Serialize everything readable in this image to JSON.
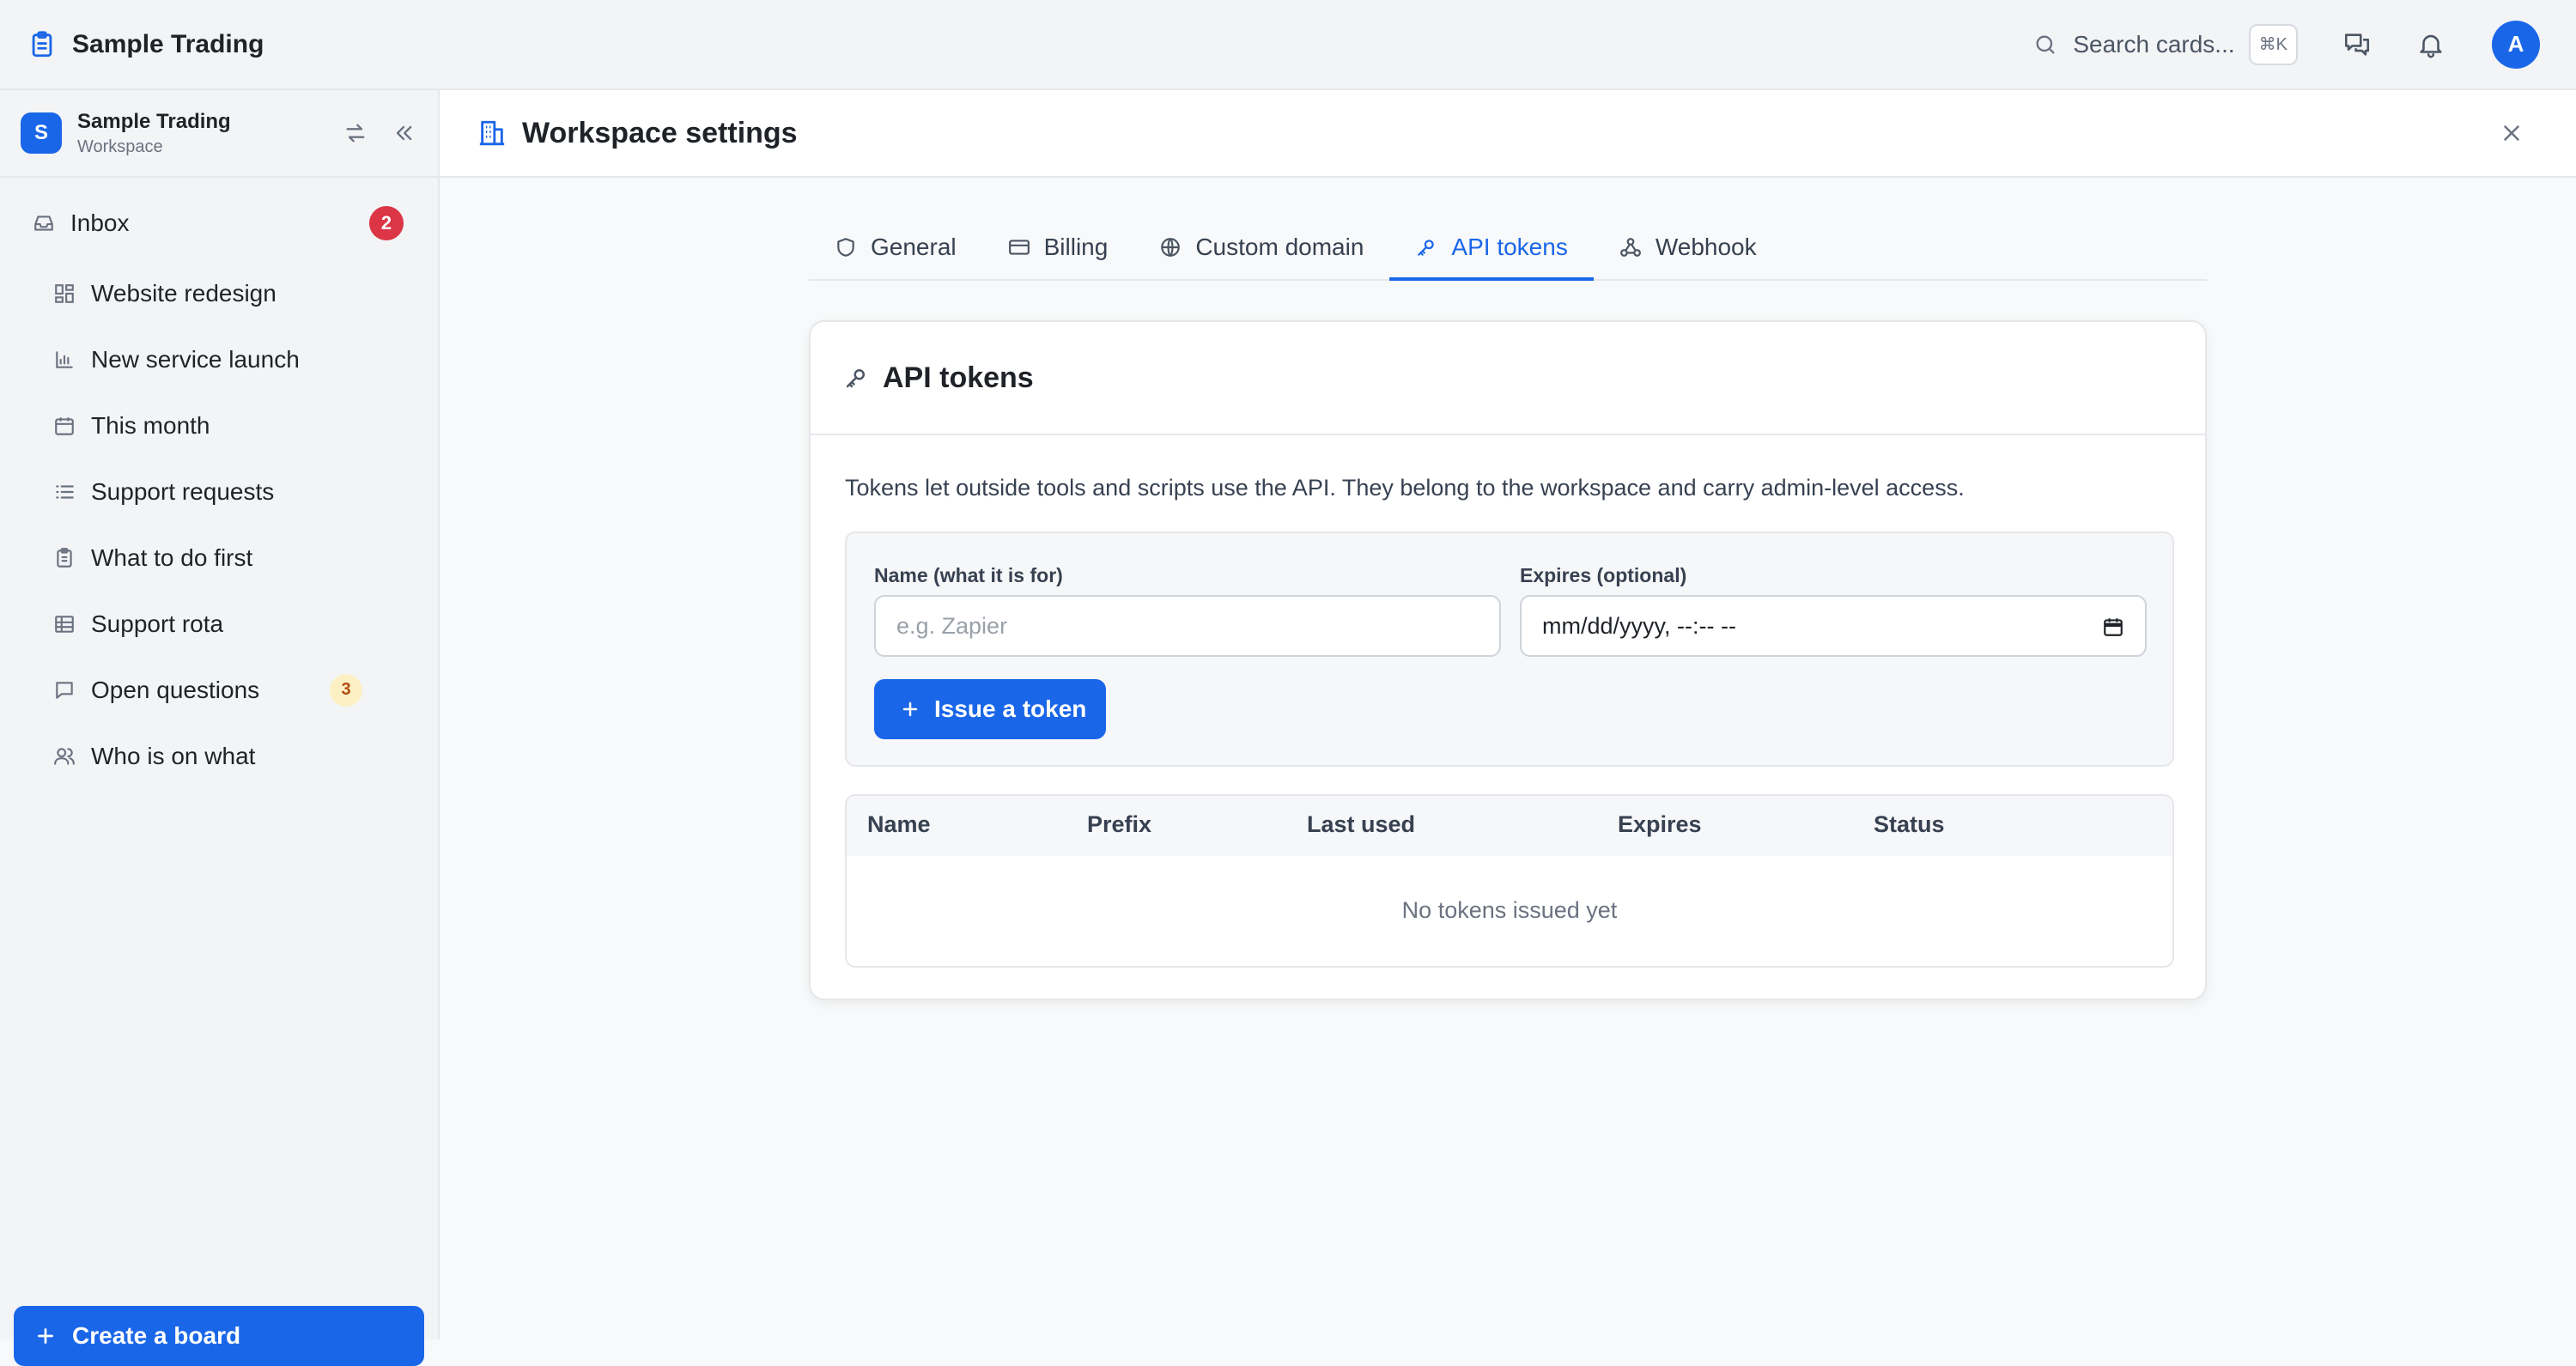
{
  "app": {
    "title": "Sample Trading",
    "search_placeholder": "Search cards...",
    "search_shortcut": "⌘K",
    "avatar_initial": "A",
    "accent_color": "#1a66e8"
  },
  "sidebar": {
    "workspace_initial": "S",
    "workspace_name": "Sample Trading",
    "workspace_type": "Workspace",
    "inbox": {
      "label": "Inbox",
      "badge": "2"
    },
    "items": [
      {
        "label": "Website redesign",
        "icon": "dashboard-grid-icon"
      },
      {
        "label": "New service launch",
        "icon": "chart-icon"
      },
      {
        "label": "This month",
        "icon": "calendar-icon"
      },
      {
        "label": "Support requests",
        "icon": "list-icon"
      },
      {
        "label": "What to do first",
        "icon": "clipboard-icon"
      },
      {
        "label": "Support rota",
        "icon": "table-icon"
      },
      {
        "label": "Open questions",
        "icon": "chat-bubble-icon",
        "badge": "3"
      },
      {
        "label": "Who is on what",
        "icon": "users-icon"
      }
    ],
    "create_label": "Create a board"
  },
  "main": {
    "title": "Workspace settings",
    "tabs": [
      {
        "label": "General",
        "icon": "shield-icon"
      },
      {
        "label": "Billing",
        "icon": "credit-card-icon"
      },
      {
        "label": "Custom domain",
        "icon": "globe-icon"
      },
      {
        "label": "API tokens",
        "icon": "key-icon",
        "active": true
      },
      {
        "label": "Webhook",
        "icon": "webhook-icon"
      }
    ],
    "card": {
      "title": "API tokens",
      "description": "Tokens let outside tools and scripts use the API. They belong to the workspace and carry admin-level access.",
      "name_label": "Name (what it is for)",
      "name_placeholder": "e.g. Zapier",
      "expires_label": "Expires (optional)",
      "expires_value": "mm/dd/yyyy, --:-- --",
      "issue_label": "Issue a token",
      "table": {
        "columns": [
          "Name",
          "Prefix",
          "Last used",
          "Expires",
          "Status"
        ],
        "empty_text": "No tokens issued yet"
      }
    }
  }
}
